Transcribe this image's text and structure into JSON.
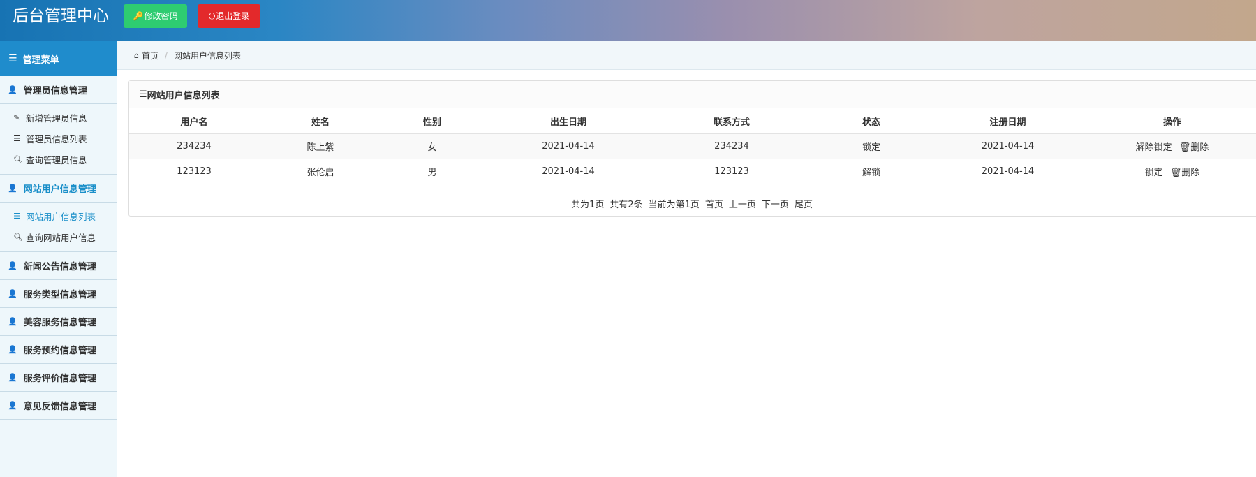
{
  "header": {
    "title": "后台管理中心",
    "change_password_label": "修改密码",
    "logout_label": "退出登录",
    "key_icon": "key-icon",
    "power_icon": "power-icon",
    "green": "#2ecc71",
    "red": "#e3292b"
  },
  "sidebar": {
    "title": "管理菜单",
    "groups": [
      {
        "label": "管理员信息管理",
        "items": [
          "新增管理员信息",
          "管理员信息列表",
          "查询管理员信息"
        ]
      },
      {
        "label": "网站用户信息管理",
        "items": [
          "网站用户信息列表",
          "查询网站用户信息"
        ]
      },
      {
        "label": "新闻公告信息管理"
      },
      {
        "label": "服务类型信息管理"
      },
      {
        "label": "美容服务信息管理"
      },
      {
        "label": "服务预约信息管理"
      },
      {
        "label": "服务评价信息管理"
      },
      {
        "label": "意见反馈信息管理"
      }
    ],
    "accent": "#1a8fc9"
  },
  "breadcrumb": {
    "home": "首页",
    "current": "网站用户信息列表"
  },
  "panel": {
    "title": "网站用户信息列表",
    "columns": [
      "用户名",
      "姓名",
      "性别",
      "出生日期",
      "联系方式",
      "状态",
      "注册日期",
      "操作"
    ],
    "rows": [
      {
        "username": "234234",
        "name": "陈上紫",
        "gender": "女",
        "birth": "2021-04-14",
        "contact": "234234",
        "status": "锁定",
        "registered": "2021-04-14",
        "action1": "解除锁定",
        "action2": "删除"
      },
      {
        "username": "123123",
        "name": "张伦启",
        "gender": "男",
        "birth": "2021-04-14",
        "contact": "123123",
        "status": "解锁",
        "registered": "2021-04-14",
        "action1": "锁定",
        "action2": "删除"
      }
    ]
  },
  "pager": {
    "total_pages": "共为1页",
    "total_records": "共有2条",
    "current_page": "当前为第1页",
    "first": "首页",
    "prev": "上一页",
    "next": "下一页",
    "last": "尾页"
  }
}
